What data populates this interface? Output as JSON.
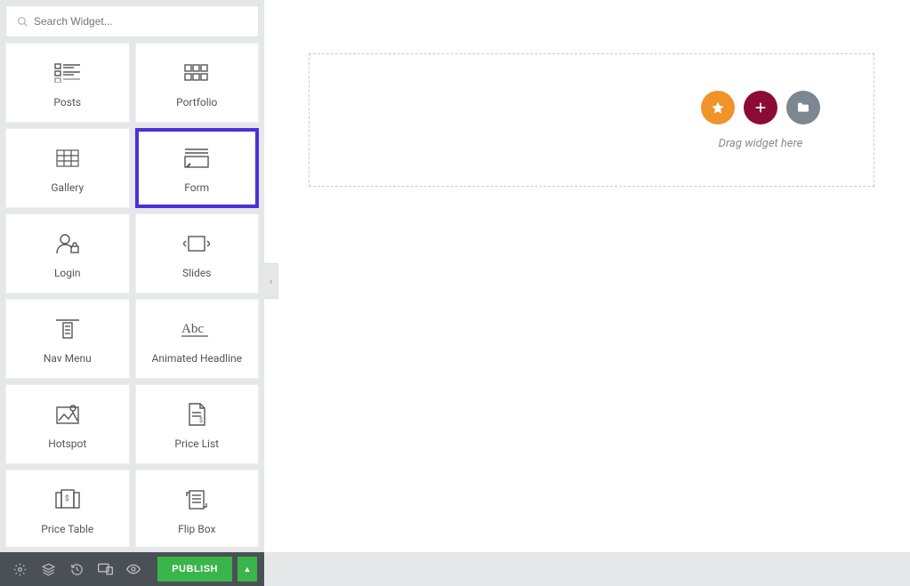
{
  "search": {
    "placeholder": "Search Widget..."
  },
  "widgets": [
    {
      "label": "Posts",
      "icon": "posts"
    },
    {
      "label": "Portfolio",
      "icon": "portfolio"
    },
    {
      "label": "Gallery",
      "icon": "gallery"
    },
    {
      "label": "Form",
      "icon": "form",
      "highlighted": true
    },
    {
      "label": "Login",
      "icon": "login"
    },
    {
      "label": "Slides",
      "icon": "slides"
    },
    {
      "label": "Nav Menu",
      "icon": "navmenu"
    },
    {
      "label": "Animated Headline",
      "icon": "headline"
    },
    {
      "label": "Hotspot",
      "icon": "hotspot"
    },
    {
      "label": "Price List",
      "icon": "pricelist"
    },
    {
      "label": "Price Table",
      "icon": "pricetable"
    },
    {
      "label": "Flip Box",
      "icon": "flipbox"
    }
  ],
  "canvas": {
    "drop_hint": "Drag widget here"
  },
  "footer": {
    "publish_label": "PUBLISH"
  }
}
